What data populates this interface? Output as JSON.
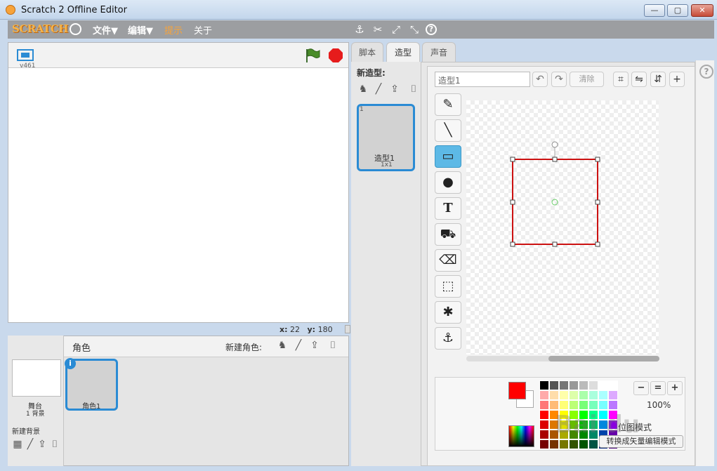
{
  "window": {
    "title": "Scratch 2 Offline Editor",
    "min": "—",
    "max": "▢",
    "close": "✕"
  },
  "menu": {
    "logo": "SCRATCH",
    "file": "文件▼",
    "edit": "编辑▼",
    "tips": "提示",
    "about": "关于"
  },
  "toolbar": {
    "duplicate": "⚓",
    "delete": "✂",
    "grow": "⤢",
    "shrink": "⤡",
    "help": "?"
  },
  "stage": {
    "version": "v461",
    "x_label": "x:",
    "x_value": "22",
    "y_label": "y:",
    "y_value": "180"
  },
  "sprites": {
    "header": "角色",
    "new_sprite": "新建角色:",
    "stage_name": "舞台",
    "stage_bg": "1 背景",
    "new_backdrop": "新建背景",
    "sprite1_name": "角色1",
    "info": "i"
  },
  "tabs": {
    "scripts": "脚本",
    "costumes": "造型",
    "sounds": "声音"
  },
  "costumes": {
    "new_label": "新造型:",
    "item_number": "1",
    "item_name": "造型1",
    "item_size": "1x1"
  },
  "paint": {
    "name_value": "造型1",
    "undo": "↶",
    "redo": "↷",
    "clear": "清除",
    "crop": "⌗",
    "flip_h": "⇋",
    "flip_v": "⇵",
    "center": "+",
    "tools": [
      "✎",
      "╲",
      "▭",
      "●",
      "T",
      "⛟",
      "⌫",
      "⬚",
      "✱",
      "⚓"
    ],
    "fg_color": "#ff0000",
    "zoom_out": "−",
    "zoom_reset": "=",
    "zoom_in": "+",
    "zoom_level": "100%",
    "mode": "位图模式",
    "convert": "转换成矢量编辑模式",
    "palette": [
      "#000000",
      "#555555",
      "#777777",
      "#999999",
      "#bbbbbb",
      "#dddddd",
      "#ffffff",
      "#ffffff",
      "#ffaaaa",
      "#ffddaa",
      "#ffffaa",
      "#ddffaa",
      "#aaffaa",
      "#aaffdd",
      "#aaffff",
      "#ddaaff",
      "#ff7777",
      "#ffbb77",
      "#ffff77",
      "#bbff77",
      "#77ff77",
      "#77ffbb",
      "#77ffff",
      "#bb77ff",
      "#ff0000",
      "#ff8800",
      "#ffff00",
      "#88ff00",
      "#00ff00",
      "#00ff88",
      "#00ffff",
      "#ff00ff",
      "#dd0000",
      "#dd7700",
      "#dddd00",
      "#66bb00",
      "#00bb00",
      "#00bb66",
      "#0088dd",
      "#8800dd",
      "#aa0000",
      "#aa5500",
      "#aaaa00",
      "#448800",
      "#008800",
      "#008866",
      "#0044aa",
      "#6600aa",
      "#770000",
      "#773300",
      "#777700",
      "#335500",
      "#005500",
      "#005544",
      "#002277",
      "#440077"
    ]
  },
  "watermark": "Bai du"
}
